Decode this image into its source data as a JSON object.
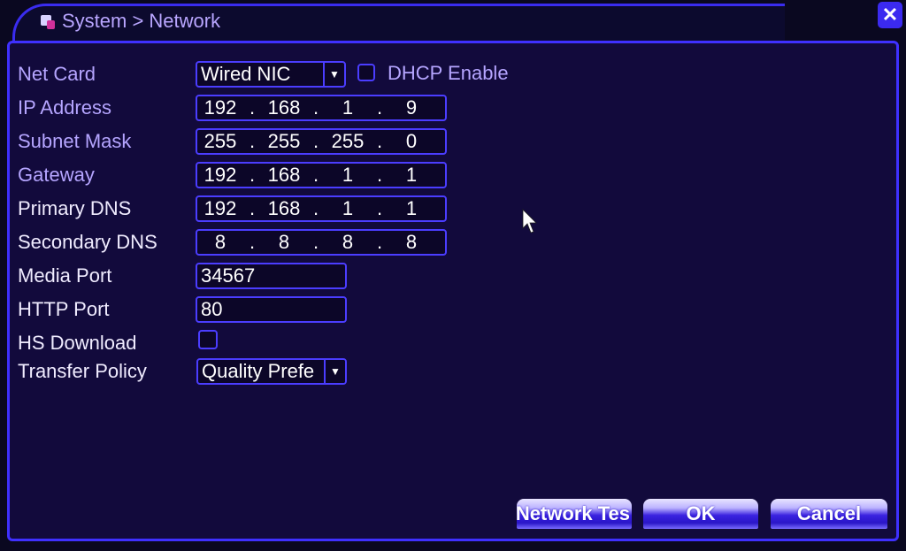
{
  "window": {
    "title": "System > Network",
    "close_label": "✕"
  },
  "form": {
    "net_card": {
      "label": "Net Card",
      "value": "Wired NIC"
    },
    "dhcp": {
      "label": "DHCP Enable",
      "checked": false
    },
    "ip_address": {
      "label": "IP Address",
      "octets": [
        "192",
        "168",
        "1",
        "9"
      ]
    },
    "subnet_mask": {
      "label": "Subnet Mask",
      "octets": [
        "255",
        "255",
        "255",
        "0"
      ]
    },
    "gateway": {
      "label": "Gateway",
      "octets": [
        "192",
        "168",
        "1",
        "1"
      ]
    },
    "primary_dns": {
      "label": "Primary DNS",
      "octets": [
        "192",
        "168",
        "1",
        "1"
      ]
    },
    "secondary_dns": {
      "label": "Secondary DNS",
      "octets": [
        "8",
        "8",
        "8",
        "8"
      ]
    },
    "media_port": {
      "label": "Media Port",
      "value": "34567"
    },
    "http_port": {
      "label": "HTTP Port",
      "value": "80"
    },
    "hs_download": {
      "label": "HS Download",
      "checked": false
    },
    "transfer_policy": {
      "label": "Transfer Policy",
      "value": "Quality Prefe"
    },
    "dot": "."
  },
  "buttons": {
    "network_test": "Network Tes",
    "ok": "OK",
    "cancel": "Cancel"
  },
  "icons": {
    "dropdown": "▼"
  }
}
